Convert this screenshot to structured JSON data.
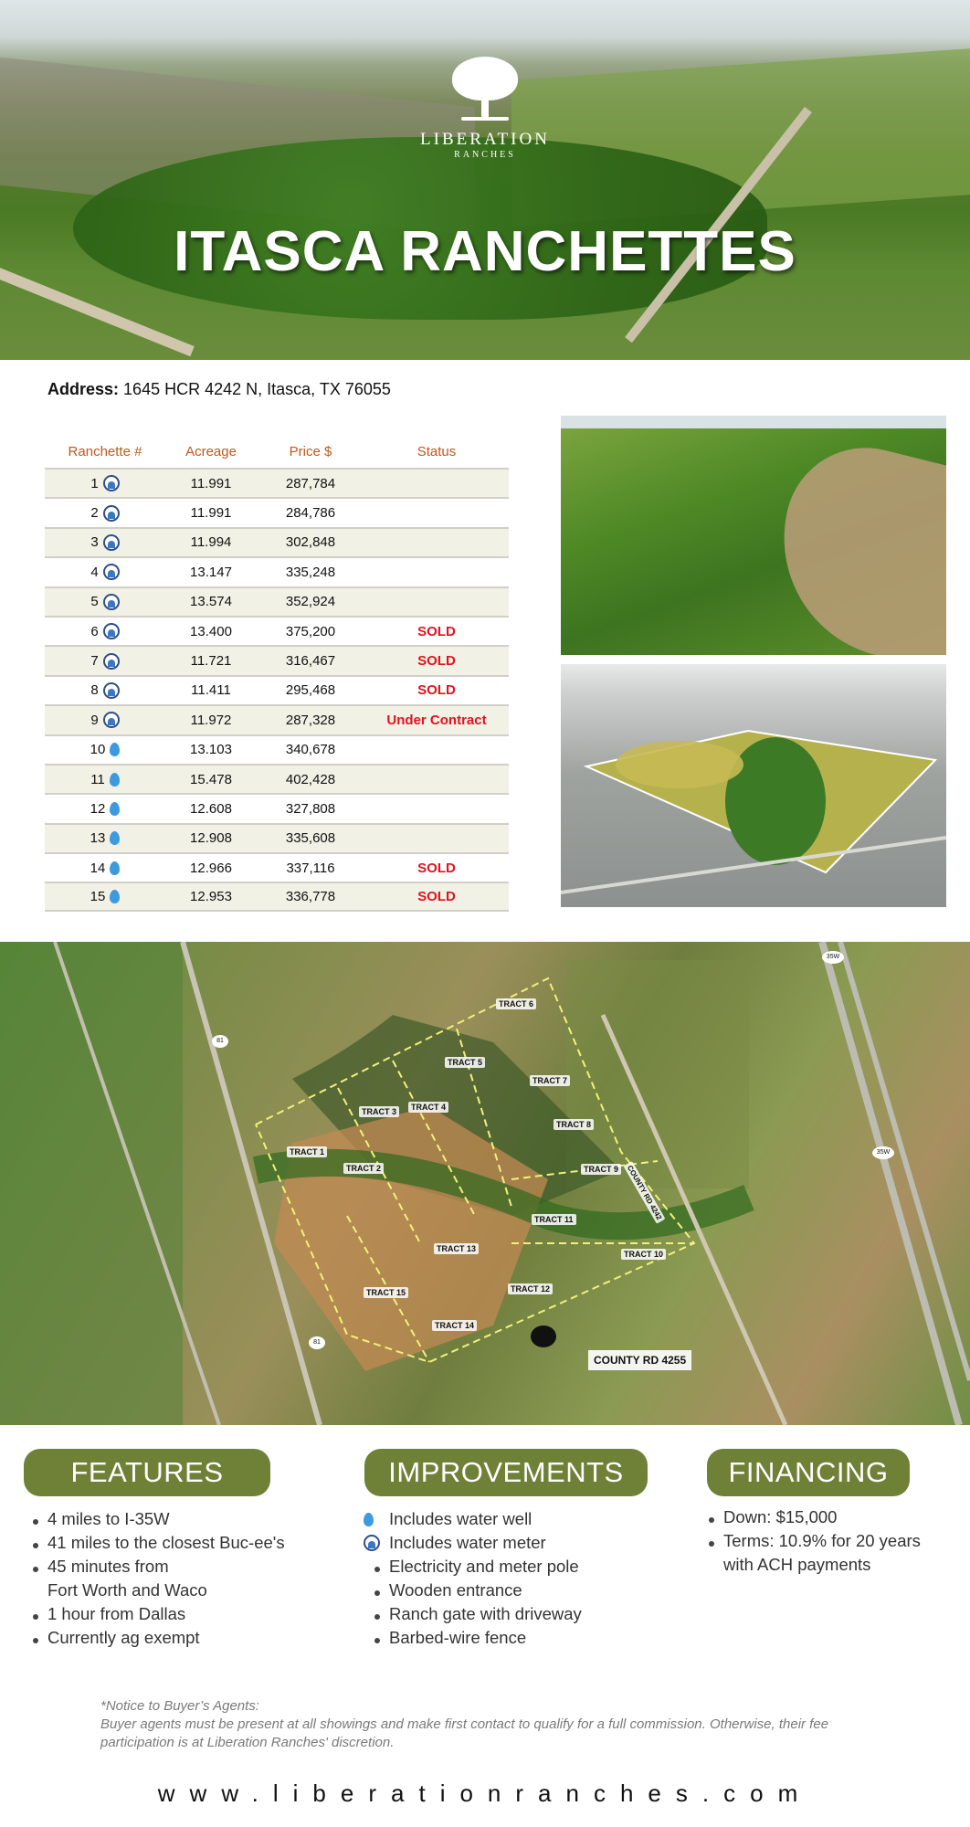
{
  "hero": {
    "logo_name": "LIBERATION",
    "logo_sub": "RANCHES",
    "title": "ITASCA RANCHETTES"
  },
  "address": {
    "label": "Address:",
    "value": "1645 HCR 4242 N, Itasca, TX 76055"
  },
  "table": {
    "headers": [
      "Ranchette #",
      "Acreage",
      "Price $",
      "Status"
    ],
    "rows": [
      {
        "num": "1",
        "icon": "water-meter-icon",
        "acreage": "11.991",
        "price": "287,784",
        "status": ""
      },
      {
        "num": "2",
        "icon": "water-meter-icon",
        "acreage": "11.991",
        "price": "284,786",
        "status": ""
      },
      {
        "num": "3",
        "icon": "water-meter-icon",
        "acreage": "11.994",
        "price": "302,848",
        "status": ""
      },
      {
        "num": "4",
        "icon": "water-meter-icon",
        "acreage": "13.147",
        "price": "335,248",
        "status": ""
      },
      {
        "num": "5",
        "icon": "water-meter-icon",
        "acreage": "13.574",
        "price": "352,924",
        "status": ""
      },
      {
        "num": "6",
        "icon": "water-meter-icon",
        "acreage": "13.400",
        "price": "375,200",
        "status": "SOLD"
      },
      {
        "num": "7",
        "icon": "water-meter-icon",
        "acreage": "11.721",
        "price": "316,467",
        "status": "SOLD"
      },
      {
        "num": "8",
        "icon": "water-meter-icon",
        "acreage": "11.411",
        "price": "295,468",
        "status": "SOLD"
      },
      {
        "num": "9",
        "icon": "water-meter-icon",
        "acreage": "11.972",
        "price": "287,328",
        "status": "Under Contract"
      },
      {
        "num": "10",
        "icon": "water-drop-icon",
        "acreage": "13.103",
        "price": "340,678",
        "status": ""
      },
      {
        "num": "11",
        "icon": "water-drop-icon",
        "acreage": "15.478",
        "price": "402,428",
        "status": ""
      },
      {
        "num": "12",
        "icon": "water-drop-icon",
        "acreage": "12.608",
        "price": "327,808",
        "status": ""
      },
      {
        "num": "13",
        "icon": "water-drop-icon",
        "acreage": "12.908",
        "price": "335,608",
        "status": ""
      },
      {
        "num": "14",
        "icon": "water-drop-icon",
        "acreage": "12.966",
        "price": "337,116",
        "status": "SOLD"
      },
      {
        "num": "15",
        "icon": "water-drop-icon",
        "acreage": "12.953",
        "price": "336,778",
        "status": "SOLD"
      }
    ]
  },
  "map": {
    "tracts": [
      "TRACT 1",
      "TRACT 2",
      "TRACT 3",
      "TRACT 4",
      "TRACT 5",
      "TRACT 6",
      "TRACT 7",
      "TRACT 8",
      "TRACT 9",
      "TRACT 10",
      "TRACT 11",
      "TRACT 12",
      "TRACT 13",
      "TRACT 14",
      "TRACT 15"
    ],
    "road_label": "COUNTY RD 4255",
    "hwy_81": "81",
    "hwy_35w": "35W",
    "road_4242": "COUNTY RD 4242"
  },
  "features": {
    "title": "FEATURES",
    "items": [
      "4 miles to I-35W",
      "41 miles to the closest Buc-ee's",
      "45 minutes from",
      "Fort Worth and Waco",
      "1 hour from Dallas",
      "Currently ag exempt"
    ]
  },
  "improvements": {
    "title": "IMPROVEMENTS",
    "items": [
      {
        "icon": "water-drop-icon",
        "text": "Includes water well"
      },
      {
        "icon": "water-meter-icon",
        "text": "Includes water meter"
      },
      {
        "icon": "",
        "text": "Electricity and meter pole"
      },
      {
        "icon": "",
        "text": "Wooden entrance"
      },
      {
        "icon": "",
        "text": "Ranch gate with driveway"
      },
      {
        "icon": "",
        "text": "Barbed-wire fence"
      }
    ]
  },
  "financing": {
    "title": "FINANCING",
    "items": [
      "Down: $15,000",
      "Terms: 10.9% for 20 years",
      "with ACH payments"
    ]
  },
  "notice": {
    "heading": "*Notice to Buyer’s Agents:",
    "body": "Buyer agents must be present at all showings and make first contact to qualify for a full commission. Otherwise, their fee participation is at Liberation Ranches' discretion."
  },
  "website": "www.liberationranches.com",
  "colors": {
    "accent_green": "#6e8136",
    "header_orange": "#c0581e",
    "sold_red": "#e0141e"
  }
}
